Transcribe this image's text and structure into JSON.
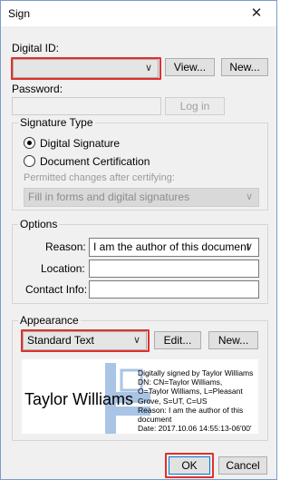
{
  "window": {
    "title": "Sign",
    "close_glyph": "✕"
  },
  "digital_id": {
    "label": "Digital ID:",
    "value": "",
    "view_button": "View...",
    "new_button": "New..."
  },
  "password": {
    "label": "Password:",
    "value": "",
    "login_button": "Log in"
  },
  "signature_type": {
    "title": "Signature Type",
    "options": [
      {
        "label": "Digital Signature",
        "selected": true
      },
      {
        "label": "Document Certification",
        "selected": false
      }
    ],
    "permitted_label": "Permitted changes after certifying:",
    "permitted_value": "Fill in forms and digital signatures"
  },
  "options": {
    "title": "Options",
    "reason_label": "Reason:",
    "reason_value": "I am the author of this document",
    "location_label": "Location:",
    "location_value": "",
    "contact_label": "Contact Info:",
    "contact_value": ""
  },
  "appearance": {
    "title": "Appearance",
    "value": "Standard Text",
    "edit_button": "Edit...",
    "new_button": "New...",
    "preview": {
      "name": "Taylor Williams",
      "details": [
        "Digitally signed by Taylor Williams",
        "DN: CN=Taylor Williams,",
        "O=Taylor Williams, L=Pleasant",
        "Grove, S=UT, C=US",
        "Reason: I am the author of this",
        "document",
        "Date: 2017.10.06 14:55:13-06'00'"
      ]
    }
  },
  "footer": {
    "ok_button": "OK",
    "cancel_button": "Cancel"
  },
  "colors": {
    "highlight": "#e0312b",
    "logo": "#a9c4e4"
  }
}
